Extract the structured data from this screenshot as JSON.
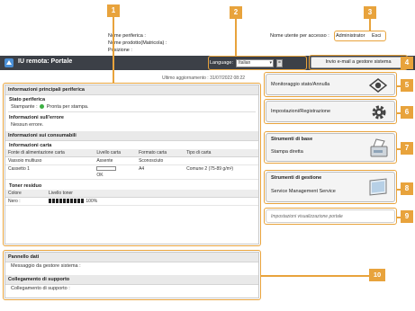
{
  "header": {
    "device_labels": [
      "Nome periferica :",
      "Nome prodotto(Matricola) :",
      "Posizione :"
    ],
    "user_label": "Nome utente per accesso :",
    "user_name": "Administrator",
    "logout": "Esci"
  },
  "titlebar": {
    "title": "IU remota: Portale",
    "language_label": "Language:",
    "language_value": "Italian",
    "send_button": "Invio e-mail a gestore sistema"
  },
  "main": {
    "refresh_text": "Ultimo aggiornamento : 31/07/2022 08:22",
    "section_title": "Informazioni principali periferica",
    "status_title": "Stato periferica",
    "printer_label": "Stampante :",
    "printer_status": "Pronta per stampa.",
    "error_title": "Informazioni sull'errore",
    "error_text": "Nessun errore.",
    "consumables_title": "Informazioni sui consumabili",
    "paper_title": "Informazioni carta",
    "paper_headers": [
      "Fonte di alimentazione carta",
      "Livello carta",
      "Formato carta",
      "Tipo di carta"
    ],
    "paper_rows": [
      {
        "source": "Vassoio multiuso",
        "level": "Assente",
        "size": "Sconosciuto",
        "type": ""
      },
      {
        "source": "Cassetto 1",
        "level": "OK",
        "size": "A4",
        "type": "Comune 2 (75-89 g/m²)"
      }
    ],
    "toner_title": "Toner residuo",
    "toner_headers": [
      "Colore",
      "Livello toner"
    ],
    "toner_rows": [
      {
        "color": "Nero :",
        "level": "100%"
      }
    ]
  },
  "side": {
    "status_button": "Monitoraggio stato/Annulla",
    "settings_button": "Impostazioni/Registrazione",
    "basic_tools_title": "Strumenti di base",
    "direct_print": "Stampa diretta",
    "mgmt_tools_title": "Strumenti di gestione",
    "service_mgmt": "Service Management Service",
    "portal_settings": "Impostazioni visualizzazione portale"
  },
  "bottom": {
    "bulletin_title": "Pannello dati",
    "bulletin_text": "Messaggio da gestore sistema :",
    "support_title": "Collegamento di supporto",
    "support_text": "Collegamento di supporto :"
  },
  "callouts": [
    "1",
    "2",
    "3",
    "4",
    "5",
    "6",
    "7",
    "8",
    "9",
    "10"
  ],
  "colors": {
    "callout": "#e8a33c",
    "titlebar": "#3c4047",
    "status_ok": "#3cb043"
  }
}
